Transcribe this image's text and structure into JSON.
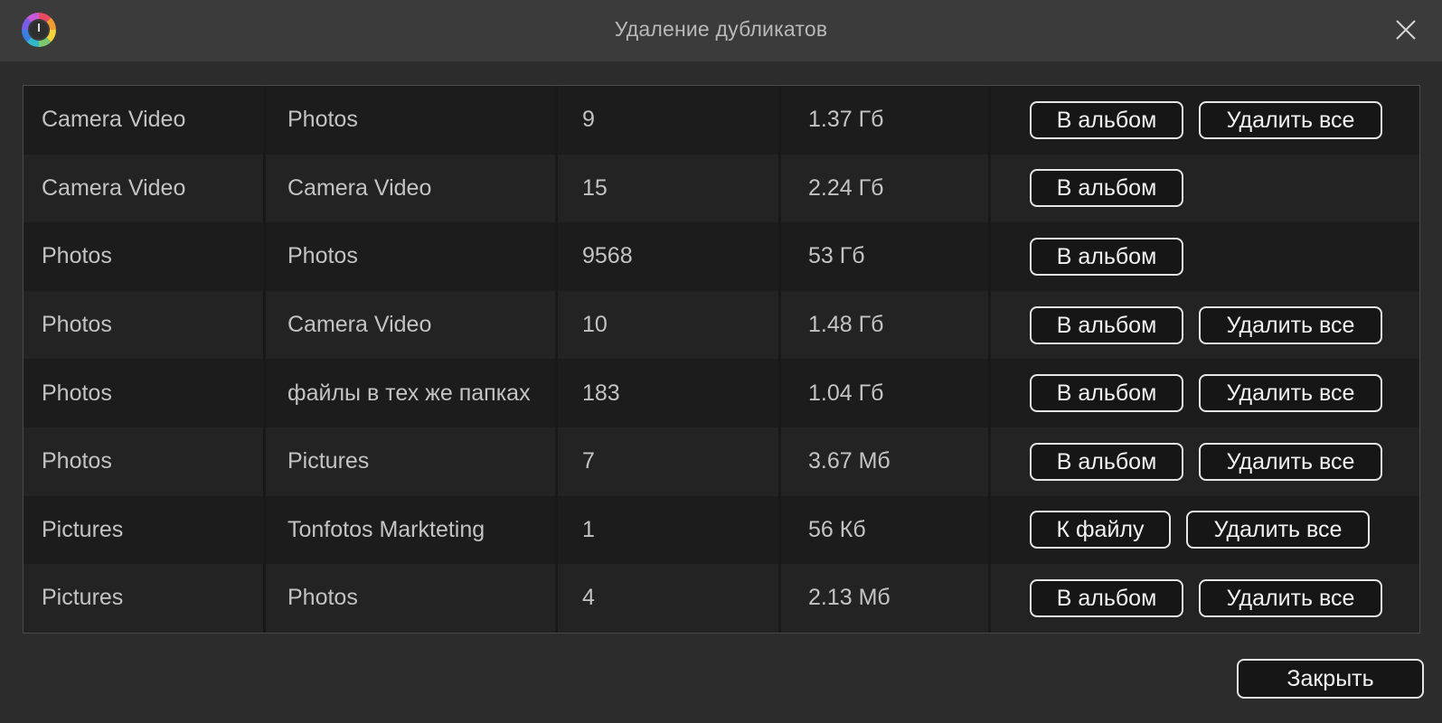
{
  "window": {
    "title": "Удаление дубликатов",
    "close_icon": "close-icon",
    "logo_icon": "app-logo-icon"
  },
  "table": {
    "rows": [
      {
        "source": "Camera Video",
        "target": "Photos",
        "count": "9",
        "size": "1.37 Гб",
        "primary_action": "В альбом",
        "delete_action": "Удалить все"
      },
      {
        "source": "Camera Video",
        "target": "Camera Video",
        "count": "15",
        "size": "2.24 Гб",
        "primary_action": "В альбом",
        "delete_action": null
      },
      {
        "source": "Photos",
        "target": "Photos",
        "count": "9568",
        "size": "53 Гб",
        "primary_action": "В альбом",
        "delete_action": null
      },
      {
        "source": "Photos",
        "target": "Camera Video",
        "count": "10",
        "size": "1.48 Гб",
        "primary_action": "В альбом",
        "delete_action": "Удалить все"
      },
      {
        "source": "Photos",
        "target": "файлы в тех же папках",
        "count": "183",
        "size": "1.04 Гб",
        "primary_action": "В альбом",
        "delete_action": "Удалить все"
      },
      {
        "source": "Photos",
        "target": "Pictures",
        "count": "7",
        "size": "3.67 Мб",
        "primary_action": "В альбом",
        "delete_action": "Удалить все"
      },
      {
        "source": "Pictures",
        "target": "Tonfotos Markteting",
        "count": "1",
        "size": "56 Кб",
        "primary_action": "К файлу",
        "delete_action": "Удалить все"
      },
      {
        "source": "Pictures",
        "target": "Photos",
        "count": "4",
        "size": "2.13 Мб",
        "primary_action": "В альбом",
        "delete_action": "Удалить все"
      }
    ]
  },
  "footer": {
    "close_label": "Закрыть"
  }
}
